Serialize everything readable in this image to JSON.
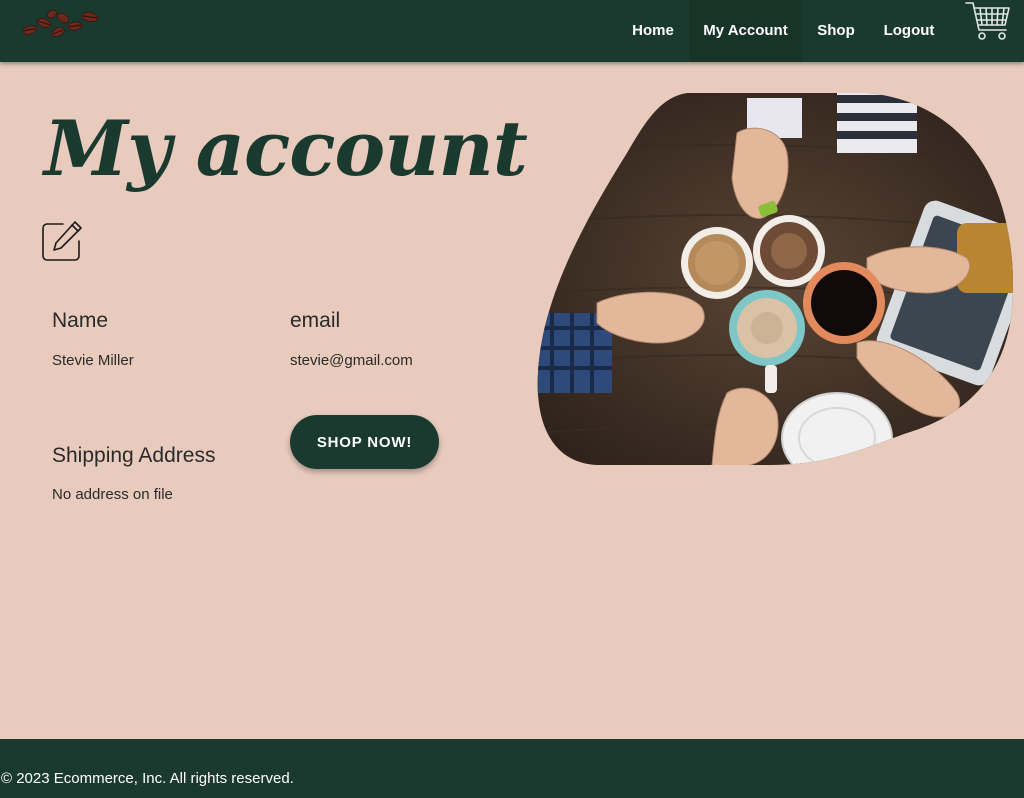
{
  "nav": {
    "items": [
      {
        "label": "Home"
      },
      {
        "label": "My Account"
      },
      {
        "label": "Shop"
      },
      {
        "label": "Logout"
      }
    ],
    "logo_icon": "coffee-beans-icon",
    "cart_icon": "shopping-cart-icon"
  },
  "page": {
    "title": "My account",
    "edit_icon": "edit-pencil-icon"
  },
  "profile": {
    "name_label": "Name",
    "name_value": "Stevie Miller",
    "email_label": "email",
    "email_value": "stevie@gmail.com",
    "shipping_label": "Shipping Address",
    "shipping_value": "No address on file"
  },
  "actions": {
    "shop_now_label": "SHOP NOW!"
  },
  "footer": {
    "copyright": "© 2023 Ecommerce, Inc. All rights reserved."
  },
  "colors": {
    "primary": "#1b3a2f",
    "background": "#e8cbbd",
    "nav_text": "#ffffff"
  }
}
